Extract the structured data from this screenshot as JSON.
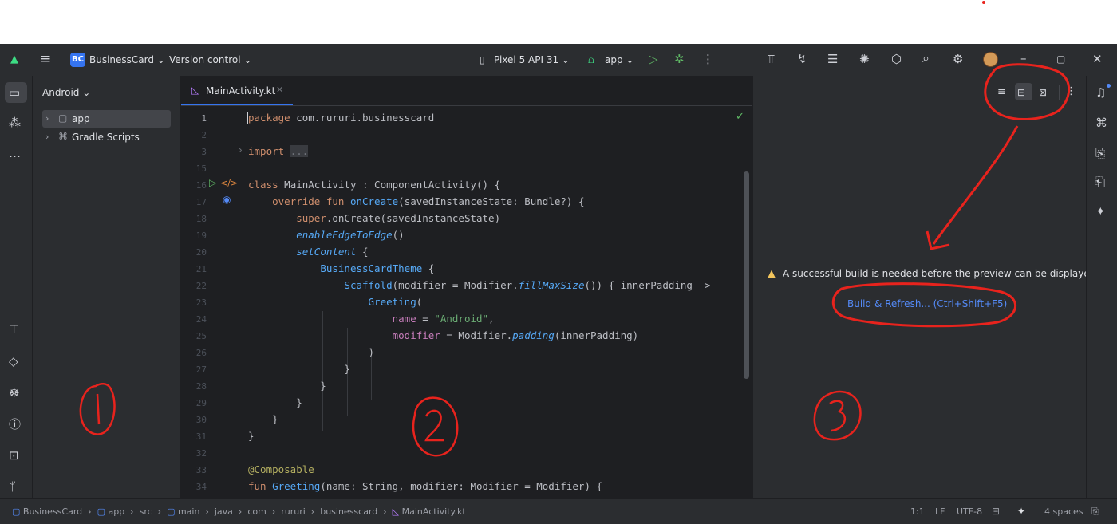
{
  "titlebar": {
    "project_initials": "BC",
    "project_name": "BusinessCard ⌄",
    "version_control": "Version control ⌄",
    "device": "Pixel 5 API 31 ⌄",
    "run_config": "app ⌄"
  },
  "project_panel": {
    "view_mode": "Android ⌄",
    "tree": [
      {
        "label": "app"
      },
      {
        "label": "Gradle Scripts"
      }
    ]
  },
  "editor": {
    "tab_label": "MainActivity.kt",
    "line_numbers": [
      "1",
      "2",
      "3",
      "15",
      "16",
      "17",
      "18",
      "19",
      "20",
      "21",
      "22",
      "23",
      "24",
      "25",
      "26",
      "27",
      "28",
      "29",
      "30",
      "31",
      "32",
      "33",
      "34"
    ]
  },
  "preview": {
    "warning_text": "A successful build is needed before the preview can be displayed",
    "build_link": "Build & Refresh... (Ctrl+Shift+F5)"
  },
  "status_bar": {
    "breadcrumbs": [
      "BusinessCard",
      "app",
      "src",
      "main",
      "java",
      "com",
      "rururi",
      "businesscard",
      "MainActivity.kt"
    ],
    "position": "1:1",
    "line_ending": "LF",
    "encoding": "UTF-8",
    "indent": "4 spaces"
  },
  "colors": {
    "accent": "#3574f0",
    "annotation": "#e8231d",
    "background": "#2b2d30",
    "editor_bg": "#1e1f22"
  }
}
